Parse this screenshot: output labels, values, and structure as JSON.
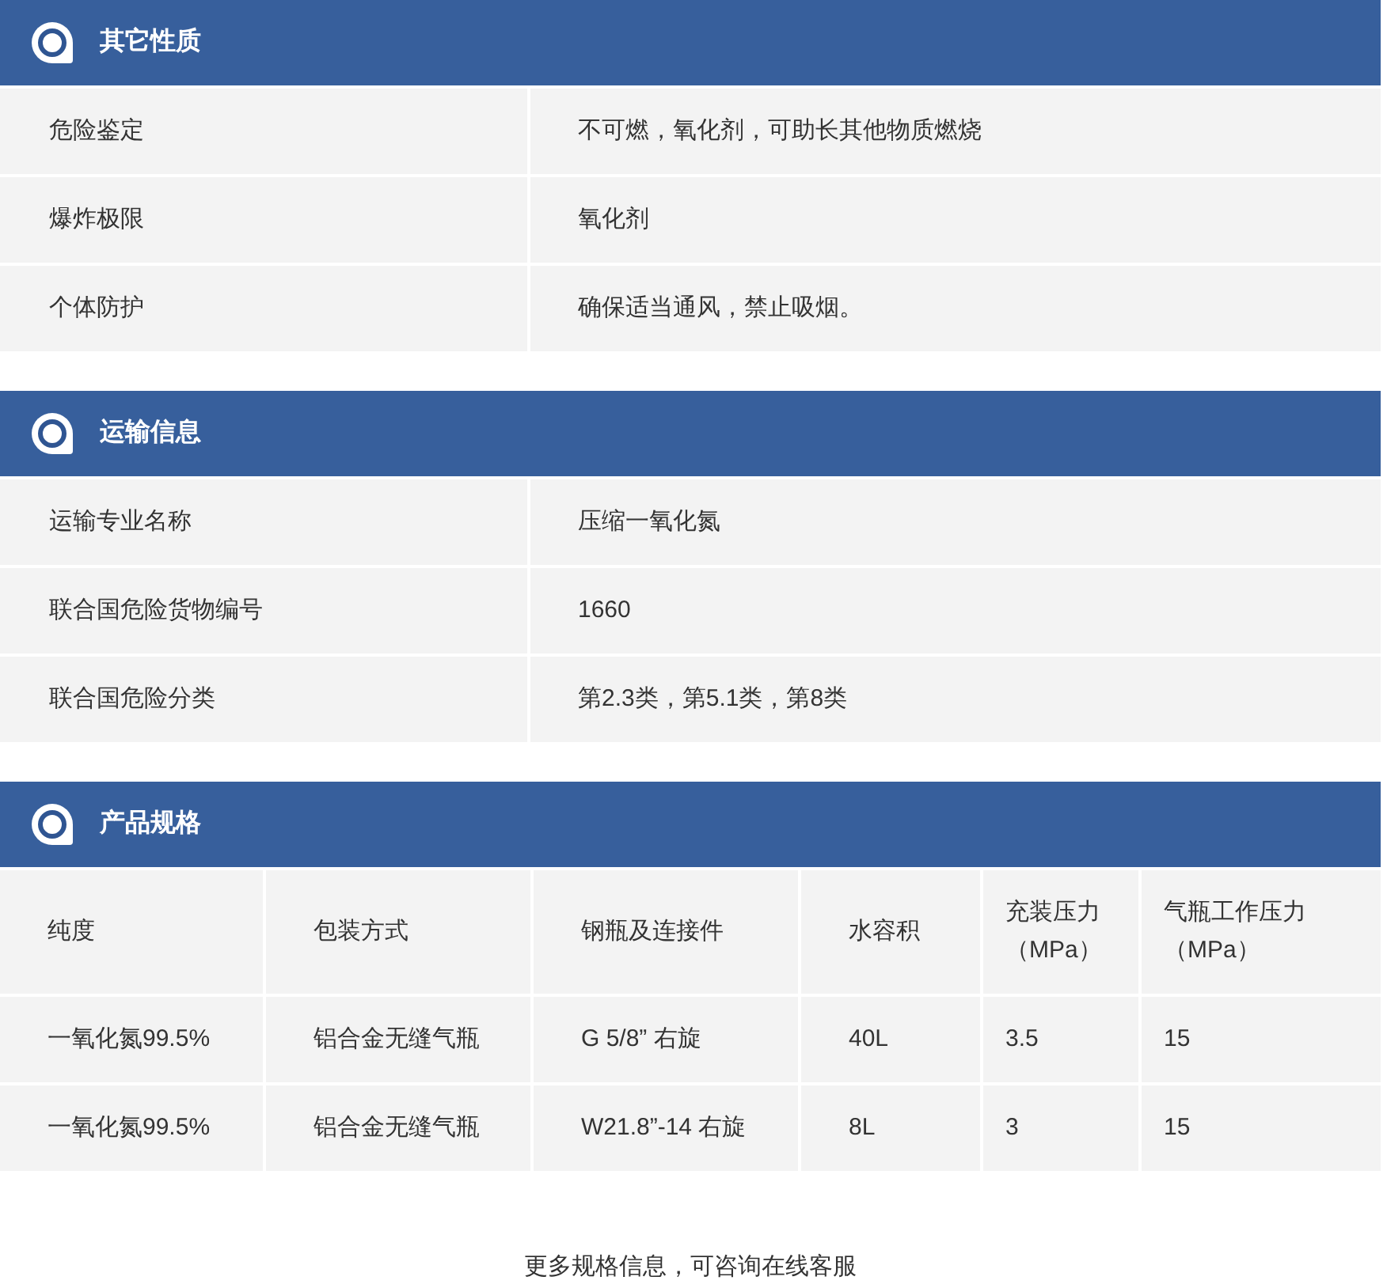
{
  "sections": [
    {
      "title": "其它性质",
      "kind": "pairs",
      "rows": [
        {
          "label": "危险鉴定",
          "value": "不可燃，氧化剂，可助长其他物质燃烧"
        },
        {
          "label": "爆炸极限",
          "value": "氧化剂"
        },
        {
          "label": "个体防护",
          "value": "确保适当通风，禁止吸烟。"
        }
      ]
    },
    {
      "title": "运输信息",
      "kind": "pairs",
      "rows": [
        {
          "label": "运输专业名称",
          "value": "压缩一氧化氮"
        },
        {
          "label": "联合国危险货物编号",
          "value": "1660"
        },
        {
          "label": "联合国危险分类",
          "value": "第2.3类，第5.1类，第8类"
        }
      ]
    },
    {
      "title": "产品规格",
      "kind": "table",
      "columns": [
        "纯度",
        "包装方式",
        "钢瓶及连接件",
        "水容积",
        "充装压力（MPa）",
        "气瓶工作压力（MPa）"
      ],
      "rows": [
        [
          "一氧化氮99.5%",
          "铝合金无缝气瓶",
          "G 5/8” 右旋",
          "40L",
          "3.5",
          "15"
        ],
        [
          "一氧化氮99.5%",
          "铝合金无缝气瓶",
          "W21.8”-14 右旋",
          "8L",
          "3",
          "15"
        ]
      ]
    }
  ],
  "footer_note": "更多规格信息，可咨询在线客服"
}
